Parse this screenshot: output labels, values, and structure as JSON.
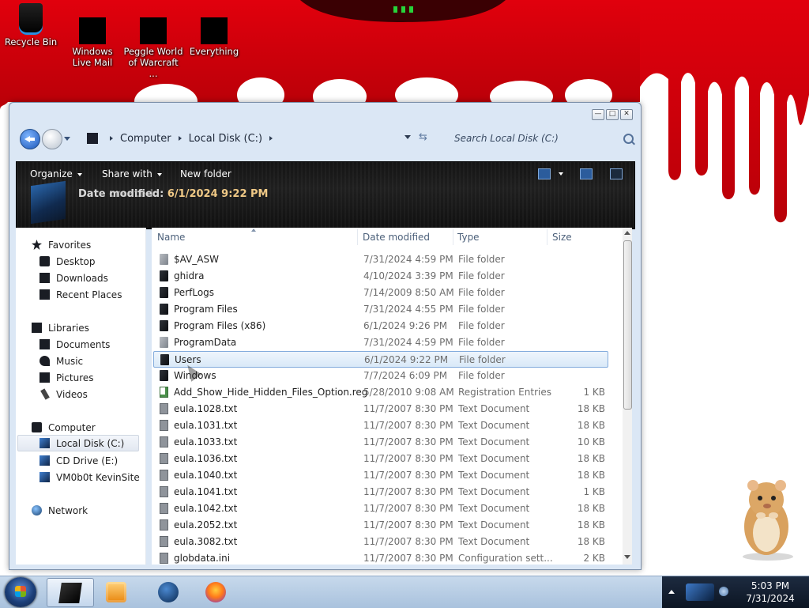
{
  "colors": {
    "wallpaper_red": "#d9000a",
    "toolbar_bg": "#141414",
    "selection_border": "#84acdd",
    "details_value": "#f0c986"
  },
  "desktop": {
    "icons": [
      {
        "label": "Recycle Bin",
        "icon": "recycle-bin-icon"
      },
      {
        "label": "Windows Live Mail",
        "icon": "windows-live-mail-icon"
      },
      {
        "label": "Peggle World of Warcraft ...",
        "icon": "peggle-icon"
      },
      {
        "label": "Everything",
        "icon": "everything-icon"
      }
    ]
  },
  "window": {
    "caption_buttons": {
      "minimize": "—",
      "maximize": "□",
      "close": "✕"
    },
    "breadcrumb": [
      "Computer",
      "Local Disk (C:)"
    ],
    "search_placeholder": "Search Local Disk (C:)",
    "toolbar": {
      "organize": "Organize",
      "share_with": "Share with",
      "new_folder": "New folder"
    },
    "details": {
      "ghost_text": "Date created:",
      "label": "Date modified:",
      "value": "6/1/2024 9:22 PM"
    },
    "nav": {
      "favorites": {
        "label": "Favorites",
        "items": [
          "Desktop",
          "Downloads",
          "Recent Places"
        ]
      },
      "libraries": {
        "label": "Libraries",
        "items": [
          "Documents",
          "Music",
          "Pictures",
          "Videos"
        ]
      },
      "computer": {
        "label": "Computer",
        "items": [
          "Local Disk (C:)",
          "CD Drive (E:)",
          "VM0b0t KevinSite"
        ]
      },
      "network": {
        "label": "Network"
      }
    },
    "columns": {
      "name": "Name",
      "date": "Date modified",
      "type": "Type",
      "size": "Size"
    },
    "files": [
      {
        "name": "$AV_ASW",
        "date": "7/31/2024 4:59 PM",
        "type": "File folder",
        "size": "",
        "icon": "folder-gray"
      },
      {
        "name": "ghidra",
        "date": "4/10/2024 3:39 PM",
        "type": "File folder",
        "size": "",
        "icon": "folder-dark"
      },
      {
        "name": "PerfLogs",
        "date": "7/14/2009 8:50 AM",
        "type": "File folder",
        "size": "",
        "icon": "folder-dark"
      },
      {
        "name": "Program Files",
        "date": "7/31/2024 4:55 PM",
        "type": "File folder",
        "size": "",
        "icon": "folder-dark"
      },
      {
        "name": "Program Files (x86)",
        "date": "6/1/2024 9:26 PM",
        "type": "File folder",
        "size": "",
        "icon": "folder-dark"
      },
      {
        "name": "ProgramData",
        "date": "7/31/2024 4:59 PM",
        "type": "File folder",
        "size": "",
        "icon": "folder-gray"
      },
      {
        "name": "Users",
        "date": "6/1/2024 9:22 PM",
        "type": "File folder",
        "size": "",
        "icon": "folder-dark",
        "selected": true
      },
      {
        "name": "Windows",
        "date": "7/7/2024 6:09 PM",
        "type": "File folder",
        "size": "",
        "icon": "folder-dark"
      },
      {
        "name": "Add_Show_Hide_Hidden_Files_Option.reg",
        "date": "5/28/2010 9:08 AM",
        "type": "Registration Entries",
        "size": "1 KB",
        "icon": "reg"
      },
      {
        "name": "eula.1028.txt",
        "date": "11/7/2007 8:30 PM",
        "type": "Text Document",
        "size": "18 KB",
        "icon": "doc"
      },
      {
        "name": "eula.1031.txt",
        "date": "11/7/2007 8:30 PM",
        "type": "Text Document",
        "size": "18 KB",
        "icon": "doc"
      },
      {
        "name": "eula.1033.txt",
        "date": "11/7/2007 8:30 PM",
        "type": "Text Document",
        "size": "10 KB",
        "icon": "doc"
      },
      {
        "name": "eula.1036.txt",
        "date": "11/7/2007 8:30 PM",
        "type": "Text Document",
        "size": "18 KB",
        "icon": "doc"
      },
      {
        "name": "eula.1040.txt",
        "date": "11/7/2007 8:30 PM",
        "type": "Text Document",
        "size": "18 KB",
        "icon": "doc"
      },
      {
        "name": "eula.1041.txt",
        "date": "11/7/2007 8:30 PM",
        "type": "Text Document",
        "size": "1 KB",
        "icon": "doc"
      },
      {
        "name": "eula.1042.txt",
        "date": "11/7/2007 8:30 PM",
        "type": "Text Document",
        "size": "18 KB",
        "icon": "doc"
      },
      {
        "name": "eula.2052.txt",
        "date": "11/7/2007 8:30 PM",
        "type": "Text Document",
        "size": "18 KB",
        "icon": "doc"
      },
      {
        "name": "eula.3082.txt",
        "date": "11/7/2007 8:30 PM",
        "type": "Text Document",
        "size": "18 KB",
        "icon": "doc"
      },
      {
        "name": "globdata.ini",
        "date": "11/7/2007 8:30 PM",
        "type": "Configuration sett...",
        "size": "2 KB",
        "icon": "doc"
      }
    ]
  },
  "taskbar": {
    "apps": [
      "explorer-icon",
      "media-center-icon",
      "globe-app-icon",
      "firefox-icon"
    ],
    "clock": {
      "time": "5:03 PM",
      "date": "7/31/2024"
    }
  }
}
